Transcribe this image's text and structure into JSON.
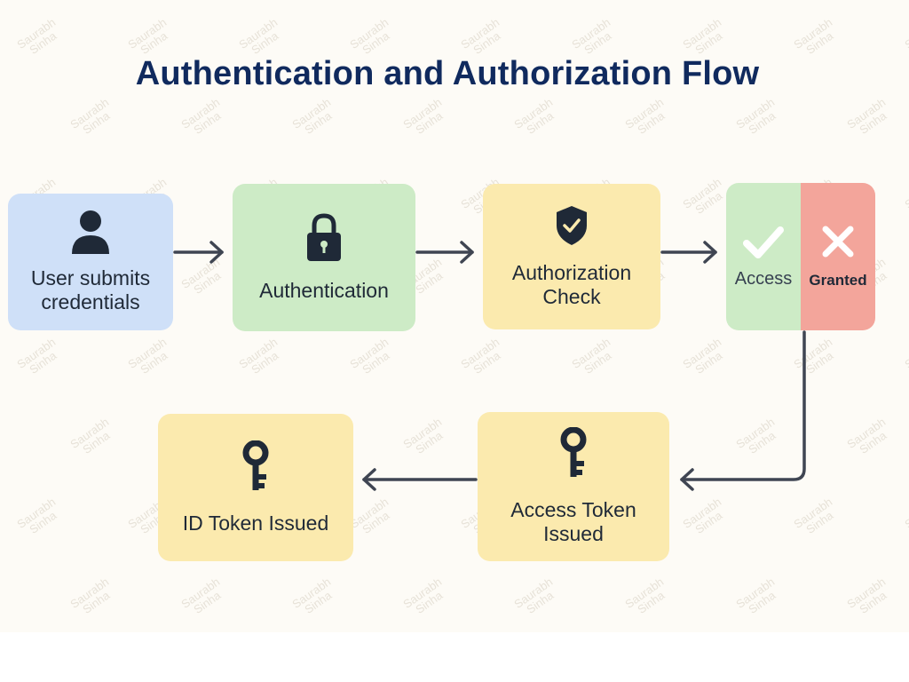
{
  "title": "Authentication and Authorization Flow",
  "watermark": "Saurabh\nSinha",
  "nodes": {
    "user": {
      "label": "User submits\ncredentials",
      "icon": "user-icon"
    },
    "authentication": {
      "label": "Authentication",
      "icon": "lock-icon"
    },
    "authorization": {
      "label": "Authorization\nCheck",
      "icon": "shield-check-icon"
    },
    "decision": {
      "access_label": "Access",
      "granted_label": "Granted",
      "icons": [
        "checkmark-icon",
        "cross-icon"
      ]
    },
    "access_token": {
      "label": "Access Token\nIssued",
      "icon": "key-icon"
    },
    "id_token": {
      "label": "ID Token Issued",
      "icon": "key-icon"
    }
  },
  "colors": {
    "title": "#102a5e",
    "blue": "#cfe0f8",
    "green": "#cdebc6",
    "yellow": "#fbeaae",
    "red": "#f3a59b",
    "icon": "#1f2937",
    "arrow": "#3f4552"
  }
}
